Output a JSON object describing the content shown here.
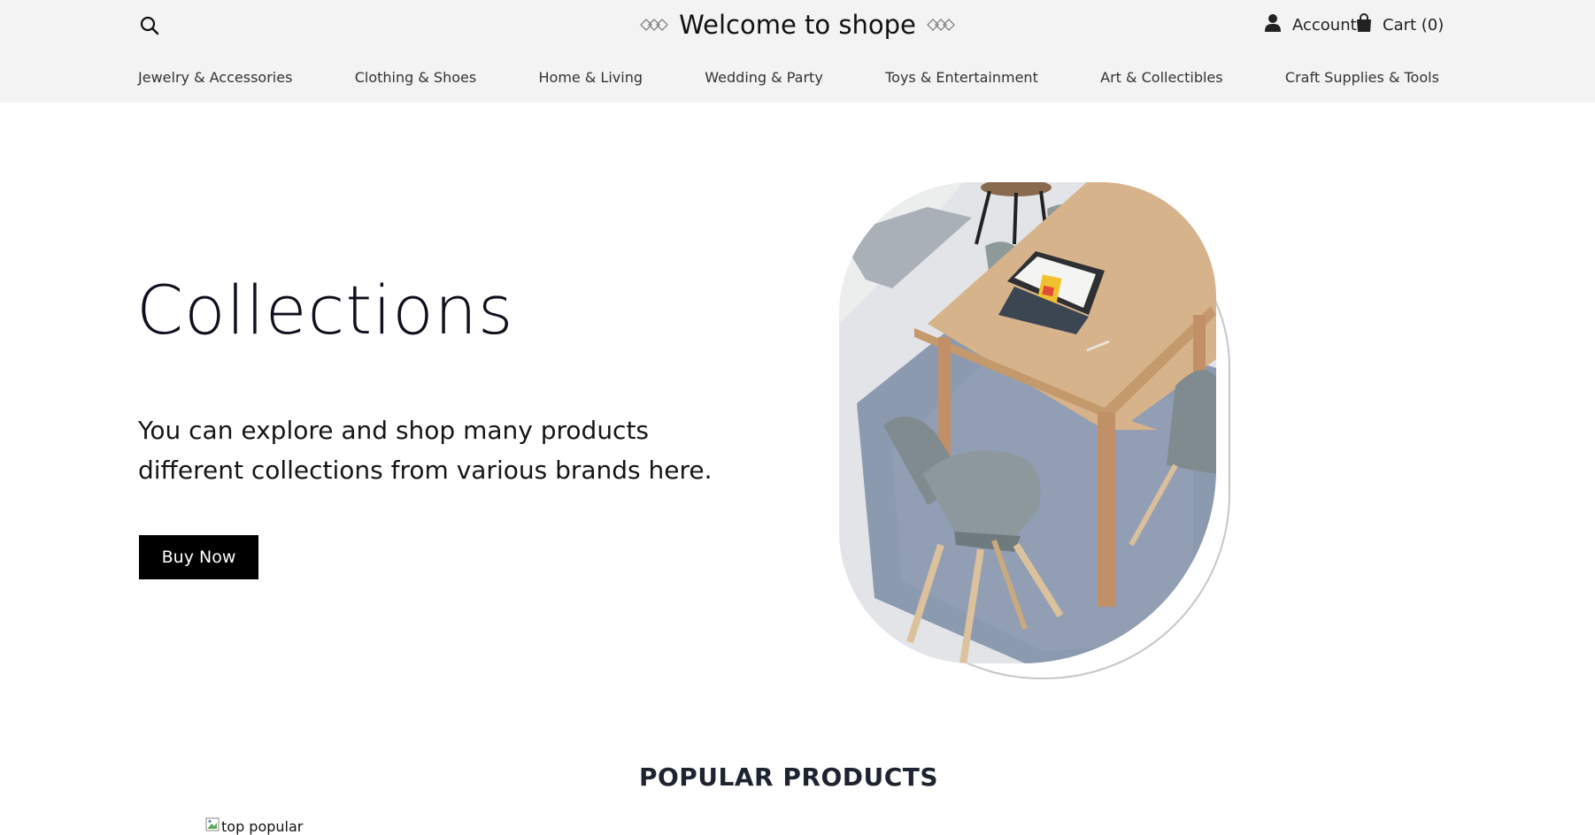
{
  "header": {
    "site_title": "Welcome to shope",
    "account_label": "Account",
    "cart_label": "Cart (0)",
    "icons": {
      "search": "search-icon",
      "brand_left": "diamond-ornament-icon",
      "brand_right": "diamond-ornament-icon",
      "account": "user-icon",
      "cart": "shopping-bag-icon"
    }
  },
  "nav": {
    "items": [
      "Jewelry & Accessories",
      "Clothing & Shoes",
      "Home & Living",
      "Wedding & Party",
      "Toys & Entertainment",
      "Art & Collectibles",
      "Craft Supplies & Tools"
    ]
  },
  "hero": {
    "title": "Collections",
    "description": "You can explore and shop many products different collections from various brands here.",
    "button_label": "Buy Now"
  },
  "popular": {
    "title": "POPULAR PRODUCTS",
    "image_alt": "top popular"
  },
  "colors": {
    "header_bg": "#f3f3f3",
    "button_bg": "#000000",
    "button_text": "#ffffff",
    "heading": "#1d2430"
  }
}
